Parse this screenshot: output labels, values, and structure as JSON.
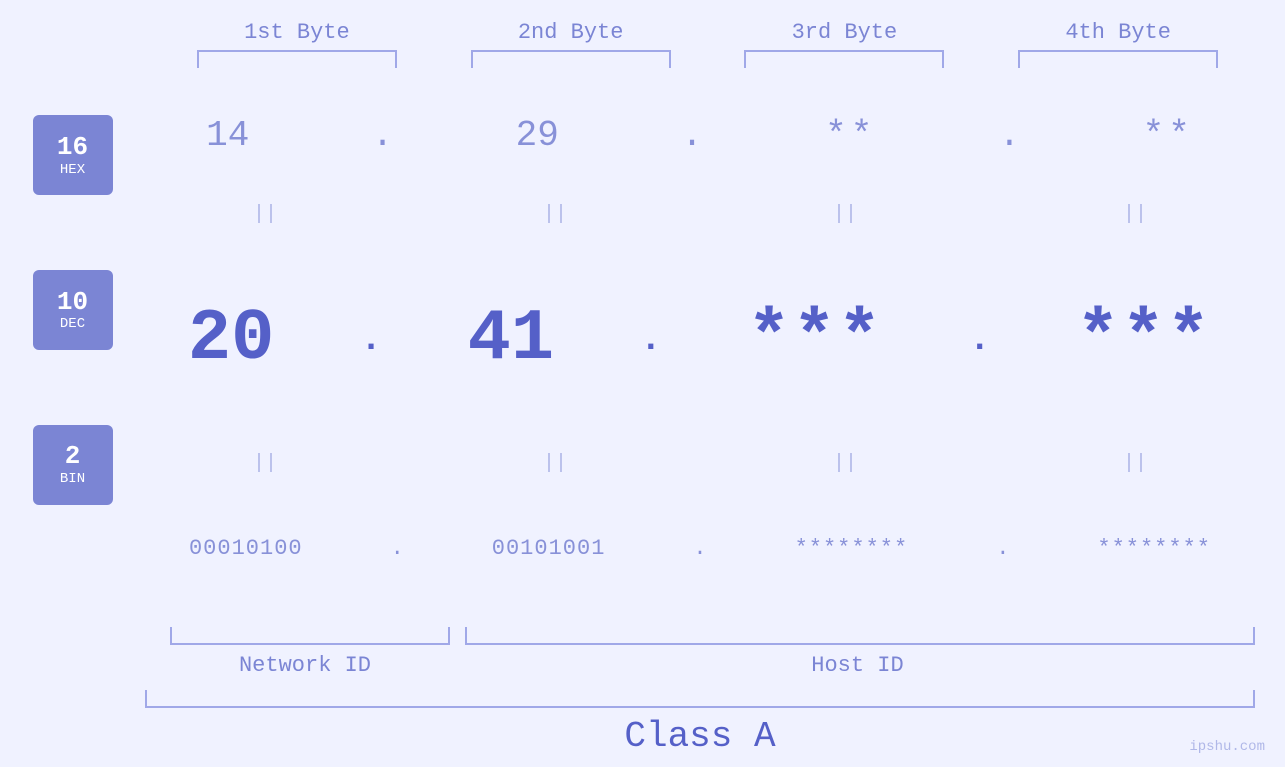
{
  "header": {
    "byte1_label": "1st Byte",
    "byte2_label": "2nd Byte",
    "byte3_label": "3rd Byte",
    "byte4_label": "4th Byte"
  },
  "badges": {
    "hex": {
      "num": "16",
      "label": "HEX"
    },
    "dec": {
      "num": "10",
      "label": "DEC"
    },
    "bin": {
      "num": "2",
      "label": "BIN"
    }
  },
  "values": {
    "hex": {
      "b1": "14",
      "b2": "29",
      "b3": "**",
      "b4": "**"
    },
    "dec": {
      "b1": "20",
      "b2": "41",
      "b3": "***",
      "b4": "***"
    },
    "bin": {
      "b1": "00010100",
      "b2": "00101001",
      "b3": "********",
      "b4": "********"
    }
  },
  "labels": {
    "network_id": "Network ID",
    "host_id": "Host ID",
    "class": "Class A"
  },
  "watermark": "ipshu.com",
  "equals": "||",
  "dot": "."
}
